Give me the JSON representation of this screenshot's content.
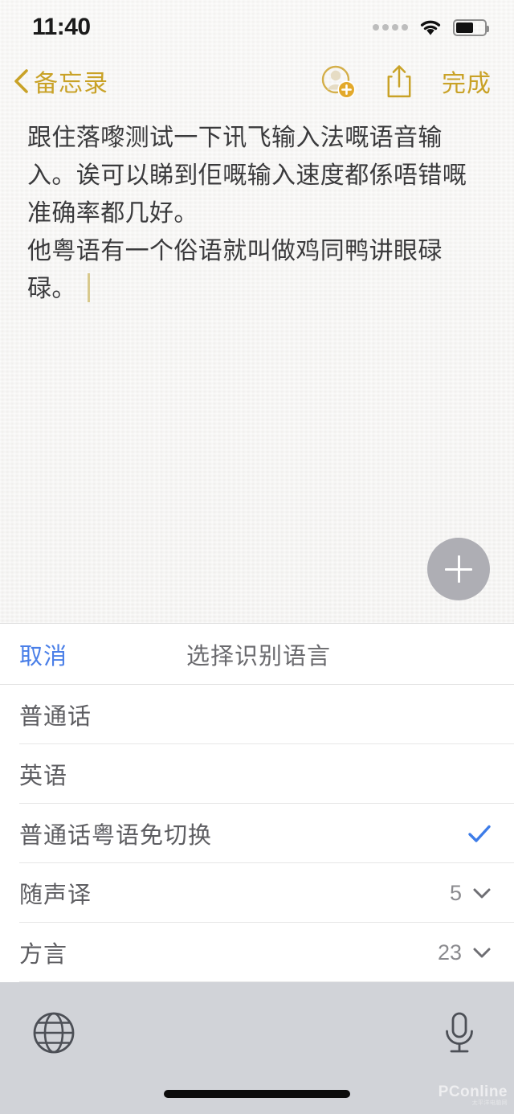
{
  "status_bar": {
    "time": "11:40",
    "signal_icon": "signal-dots-icon",
    "wifi_icon": "wifi-icon",
    "battery_icon": "battery-icon",
    "battery_level_percent": 62
  },
  "nav_bar": {
    "back_label": "备忘录",
    "back_icon": "chevron-left-icon",
    "add_person_icon": "add-person-icon",
    "share_icon": "share-icon",
    "done_label": "完成"
  },
  "note": {
    "lines": [
      "跟住落嚟测试一下讯飞输入法嘅语音输入。诶可以睇到佢嘅输入速度都係唔错嘅准确率都几好。",
      "他粤语有一个俗语就叫做鸡同鸭讲眼碌碌。"
    ],
    "add_button_icon": "plus-icon"
  },
  "sheet": {
    "cancel_label": "取消",
    "title": "选择识别语言",
    "accent_color": "#4a7fe8",
    "options": [
      {
        "label": "普通话",
        "selected": false,
        "count": ""
      },
      {
        "label": "英语",
        "selected": false,
        "count": ""
      },
      {
        "label": "普通话粤语免切换",
        "selected": true,
        "count": ""
      },
      {
        "label": "随声译",
        "selected": false,
        "count": "5"
      },
      {
        "label": "方言",
        "selected": false,
        "count": "23"
      }
    ],
    "check_icon": "check-icon",
    "chevron_icon": "chevron-down-icon"
  },
  "keyboard_toolbar": {
    "globe_icon": "globe-icon",
    "mic_icon": "microphone-icon",
    "background_color": "#d1d3d8"
  },
  "watermark": {
    "text": "PConline",
    "sub": "太平洋电脑网"
  }
}
